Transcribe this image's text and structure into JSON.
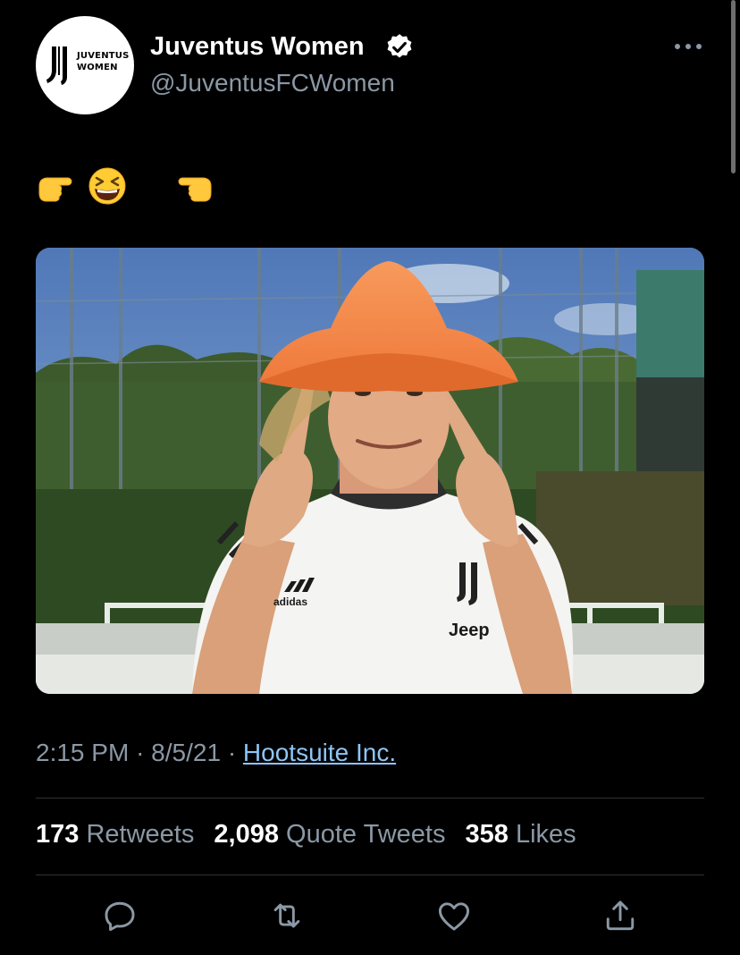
{
  "author": {
    "avatar_text_line1": "JUVENTUS",
    "avatar_text_line2": "WOMEN",
    "display_name": "Juventus Women",
    "handle": "@JuventusFCWomen",
    "verified": true
  },
  "tweet": {
    "emojis": [
      "pointing-right-hand",
      "laughing-face-eyes-closed",
      "pointing-left-hand"
    ]
  },
  "meta": {
    "time": "2:15 PM",
    "separator": "·",
    "date": "8/5/21",
    "source": "Hootsuite Inc."
  },
  "stats": {
    "retweets_count": "173",
    "retweets_label": "Retweets",
    "quotes_count": "2,098",
    "quotes_label": "Quote Tweets",
    "likes_count": "358",
    "likes_label": "Likes"
  },
  "photo": {
    "shirt_text": "Jeep",
    "maker_text": "adidas"
  },
  "actions": [
    "reply-icon",
    "retweet-icon",
    "like-icon",
    "share-icon"
  ],
  "colors": {
    "background": "#000000",
    "text": "#e7e9ea",
    "secondary": "#8b98a5",
    "link": "#8ec5f6",
    "verified": "#ffffff",
    "cone": "#f7894a"
  }
}
